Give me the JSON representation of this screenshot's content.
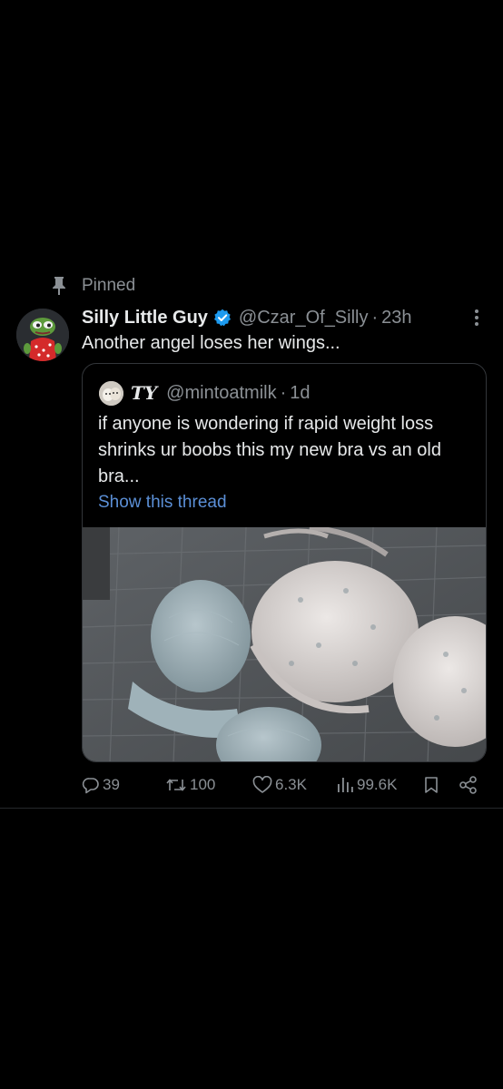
{
  "pinned_label": "Pinned",
  "tweet": {
    "display_name": "Silly Little Guy",
    "handle": "@Czar_Of_Silly",
    "separator": "·",
    "time": "23h",
    "text": "Another angel loses her wings..."
  },
  "quote": {
    "display_name": "TY",
    "handle": "@mintoatmilk",
    "separator": "·",
    "time": "1d",
    "text": "if anyone is wondering if rapid weight loss shrinks ur boobs this my new bra vs an old bra...",
    "show_thread": "Show this thread"
  },
  "actions": {
    "replies": "39",
    "retweets": "100",
    "likes": "6.3K",
    "views": "99.6K"
  },
  "icons": {
    "pin": "pin-icon",
    "verified": "verified-badge-icon",
    "more": "more-options-icon",
    "reply": "reply-icon",
    "retweet": "retweet-icon",
    "like": "heart-icon",
    "views": "views-icon",
    "bookmark": "bookmark-icon",
    "share": "share-icon"
  },
  "colors": {
    "background": "#000000",
    "text": "#e7e9ea",
    "muted": "#8b9095",
    "link": "#5b8fd6",
    "verified": "#1d9bf0",
    "border": "#33363a"
  }
}
